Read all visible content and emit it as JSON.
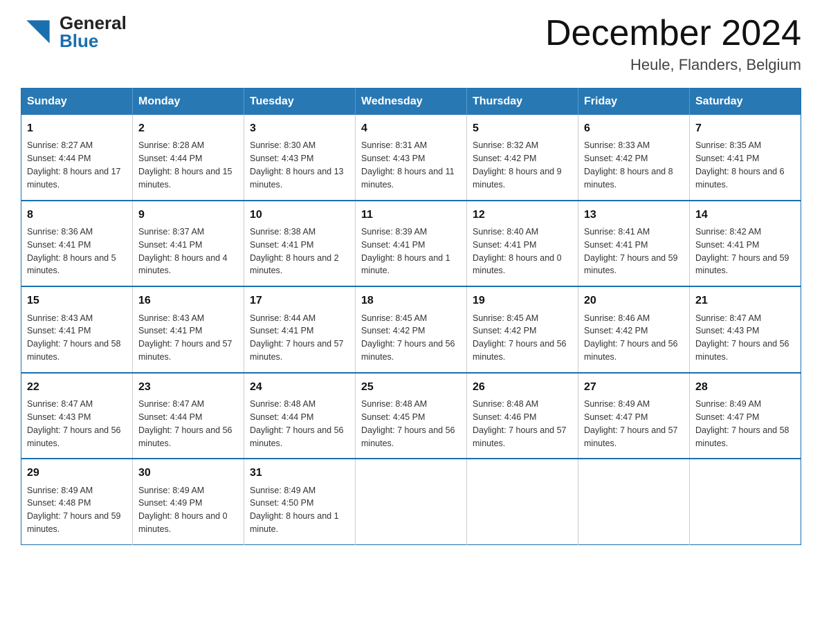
{
  "header": {
    "logo_line1": "General",
    "logo_line2": "Blue",
    "month_title": "December 2024",
    "location": "Heule, Flanders, Belgium"
  },
  "weekdays": [
    "Sunday",
    "Monday",
    "Tuesday",
    "Wednesday",
    "Thursday",
    "Friday",
    "Saturday"
  ],
  "weeks": [
    [
      {
        "day": "1",
        "sunrise": "8:27 AM",
        "sunset": "4:44 PM",
        "daylight": "8 hours and 17 minutes."
      },
      {
        "day": "2",
        "sunrise": "8:28 AM",
        "sunset": "4:44 PM",
        "daylight": "8 hours and 15 minutes."
      },
      {
        "day": "3",
        "sunrise": "8:30 AM",
        "sunset": "4:43 PM",
        "daylight": "8 hours and 13 minutes."
      },
      {
        "day": "4",
        "sunrise": "8:31 AM",
        "sunset": "4:43 PM",
        "daylight": "8 hours and 11 minutes."
      },
      {
        "day": "5",
        "sunrise": "8:32 AM",
        "sunset": "4:42 PM",
        "daylight": "8 hours and 9 minutes."
      },
      {
        "day": "6",
        "sunrise": "8:33 AM",
        "sunset": "4:42 PM",
        "daylight": "8 hours and 8 minutes."
      },
      {
        "day": "7",
        "sunrise": "8:35 AM",
        "sunset": "4:41 PM",
        "daylight": "8 hours and 6 minutes."
      }
    ],
    [
      {
        "day": "8",
        "sunrise": "8:36 AM",
        "sunset": "4:41 PM",
        "daylight": "8 hours and 5 minutes."
      },
      {
        "day": "9",
        "sunrise": "8:37 AM",
        "sunset": "4:41 PM",
        "daylight": "8 hours and 4 minutes."
      },
      {
        "day": "10",
        "sunrise": "8:38 AM",
        "sunset": "4:41 PM",
        "daylight": "8 hours and 2 minutes."
      },
      {
        "day": "11",
        "sunrise": "8:39 AM",
        "sunset": "4:41 PM",
        "daylight": "8 hours and 1 minute."
      },
      {
        "day": "12",
        "sunrise": "8:40 AM",
        "sunset": "4:41 PM",
        "daylight": "8 hours and 0 minutes."
      },
      {
        "day": "13",
        "sunrise": "8:41 AM",
        "sunset": "4:41 PM",
        "daylight": "7 hours and 59 minutes."
      },
      {
        "day": "14",
        "sunrise": "8:42 AM",
        "sunset": "4:41 PM",
        "daylight": "7 hours and 59 minutes."
      }
    ],
    [
      {
        "day": "15",
        "sunrise": "8:43 AM",
        "sunset": "4:41 PM",
        "daylight": "7 hours and 58 minutes."
      },
      {
        "day": "16",
        "sunrise": "8:43 AM",
        "sunset": "4:41 PM",
        "daylight": "7 hours and 57 minutes."
      },
      {
        "day": "17",
        "sunrise": "8:44 AM",
        "sunset": "4:41 PM",
        "daylight": "7 hours and 57 minutes."
      },
      {
        "day": "18",
        "sunrise": "8:45 AM",
        "sunset": "4:42 PM",
        "daylight": "7 hours and 56 minutes."
      },
      {
        "day": "19",
        "sunrise": "8:45 AM",
        "sunset": "4:42 PM",
        "daylight": "7 hours and 56 minutes."
      },
      {
        "day": "20",
        "sunrise": "8:46 AM",
        "sunset": "4:42 PM",
        "daylight": "7 hours and 56 minutes."
      },
      {
        "day": "21",
        "sunrise": "8:47 AM",
        "sunset": "4:43 PM",
        "daylight": "7 hours and 56 minutes."
      }
    ],
    [
      {
        "day": "22",
        "sunrise": "8:47 AM",
        "sunset": "4:43 PM",
        "daylight": "7 hours and 56 minutes."
      },
      {
        "day": "23",
        "sunrise": "8:47 AM",
        "sunset": "4:44 PM",
        "daylight": "7 hours and 56 minutes."
      },
      {
        "day": "24",
        "sunrise": "8:48 AM",
        "sunset": "4:44 PM",
        "daylight": "7 hours and 56 minutes."
      },
      {
        "day": "25",
        "sunrise": "8:48 AM",
        "sunset": "4:45 PM",
        "daylight": "7 hours and 56 minutes."
      },
      {
        "day": "26",
        "sunrise": "8:48 AM",
        "sunset": "4:46 PM",
        "daylight": "7 hours and 57 minutes."
      },
      {
        "day": "27",
        "sunrise": "8:49 AM",
        "sunset": "4:47 PM",
        "daylight": "7 hours and 57 minutes."
      },
      {
        "day": "28",
        "sunrise": "8:49 AM",
        "sunset": "4:47 PM",
        "daylight": "7 hours and 58 minutes."
      }
    ],
    [
      {
        "day": "29",
        "sunrise": "8:49 AM",
        "sunset": "4:48 PM",
        "daylight": "7 hours and 59 minutes."
      },
      {
        "day": "30",
        "sunrise": "8:49 AM",
        "sunset": "4:49 PM",
        "daylight": "8 hours and 0 minutes."
      },
      {
        "day": "31",
        "sunrise": "8:49 AM",
        "sunset": "4:50 PM",
        "daylight": "8 hours and 1 minute."
      },
      null,
      null,
      null,
      null
    ]
  ],
  "labels": {
    "sunrise_prefix": "Sunrise: ",
    "sunset_prefix": "Sunset: ",
    "daylight_prefix": "Daylight: "
  }
}
